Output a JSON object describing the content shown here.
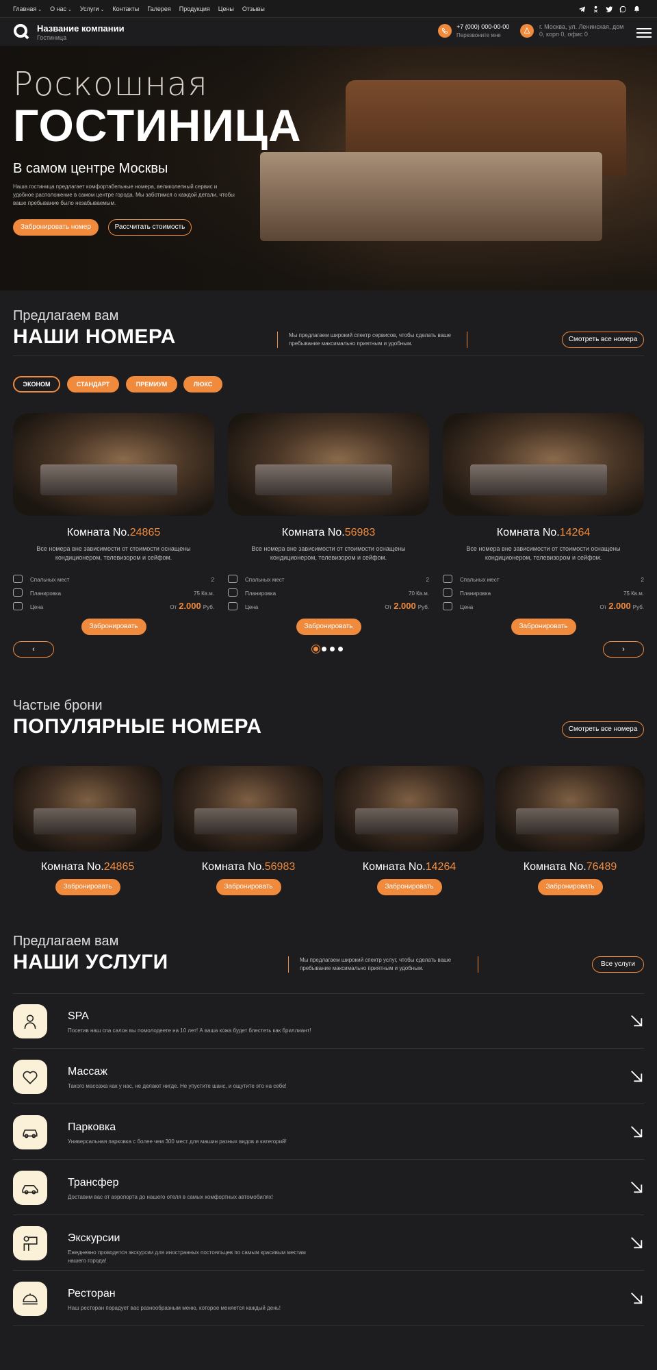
{
  "topnav": {
    "items": [
      "Главная",
      "О нас",
      "Услуги",
      "Контакты",
      "Галерея",
      "Продукция",
      "Цены",
      "Отзывы"
    ]
  },
  "socials": [
    "telegram-icon",
    "odnoklassniki-icon",
    "twitter-icon",
    "whatsapp-icon",
    "bell-icon"
  ],
  "header": {
    "company": "Название компании",
    "subtitle": "Гостиница",
    "phone": "+7 (000) 000-00-00",
    "phone_sub": "Перезвоните мне",
    "address": "г. Москва, ул. Ленинская, дом 0, корп 0, офис 0"
  },
  "hero": {
    "line1": "Роскошная",
    "line2": "ГОСТИНИЦА",
    "line3": "В самом центре Москвы",
    "desc": "Наша гостиница предлагает комфортабельные номера, великолепный сервис и удобное расположение в самом центре города. Мы заботимся о каждой детали, чтобы ваше пребывание было незабываемым.",
    "btn_book": "Забронировать номер",
    "btn_calc": "Рассчитать стоимость"
  },
  "rooms_section": {
    "small": "Предлагаем вам",
    "big": "НАШИ НОМЕРА",
    "desc": "Мы предлагаем широкий спектр сервисов, чтобы сделать ваше пребывание максимально приятным и удобным.",
    "btn": "Смотреть все номера",
    "filters": [
      "ЭКОНОМ",
      "СТАНДАРТ",
      "ПРЕМИУМ",
      "ЛЮКС"
    ],
    "active_filter": 0
  },
  "room_labels": {
    "beds": "Спальных мест",
    "layout": "Планировка",
    "price": "Цена",
    "from": "От",
    "currency": "Руб.",
    "book": "Забронировать",
    "desc": "Все номера вне зависимости от стоимости оснащены кондиционером, телевизором и сейфом."
  },
  "rooms": [
    {
      "prefix": "Комната No.",
      "num": "24865",
      "beds": "2",
      "area": "75 Кв.м.",
      "price": "2.000"
    },
    {
      "prefix": "Комната No.",
      "num": "56983",
      "beds": "2",
      "area": "70 Кв.м.",
      "price": "2.000"
    },
    {
      "prefix": "Комната No.",
      "num": "14264",
      "beds": "2",
      "area": "75 Кв.м.",
      "price": "2.000"
    }
  ],
  "slider": {
    "prev": "‹",
    "next": "›",
    "dots": 4,
    "active": 0
  },
  "popular_section": {
    "small": "Частые брони",
    "big": "ПОПУЛЯРНЫЕ НОМЕРА",
    "btn": "Смотреть все номера"
  },
  "popular": [
    {
      "prefix": "Комната No.",
      "num": "24865"
    },
    {
      "prefix": "Комната No.",
      "num": "56983"
    },
    {
      "prefix": "Комната No.",
      "num": "14264"
    },
    {
      "prefix": "Комната No.",
      "num": "76489"
    }
  ],
  "services_section": {
    "small": "Предлагаем вам",
    "big": "НАШИ УСЛУГИ",
    "desc": "Мы предлагаем широкий спектр услуг, чтобы сделать ваше пребывание максимально приятным и удобным.",
    "btn": "Все услуги"
  },
  "services": [
    {
      "title": "SPA",
      "icon": "spa-icon",
      "desc": "Посетив наш спа салон вы помолодеете на 10 лет! А ваша кожа будет блестеть как бриллиант!"
    },
    {
      "title": "Массаж",
      "icon": "massage-icon",
      "desc": "Такого массажа как у нас, не делают нигде. Не упустите шанс, и ощутите это на себе!"
    },
    {
      "title": "Парковка",
      "icon": "parking-icon",
      "desc": "Универсальная парковка с более чем 300 мест для машин разных видов и категорий!"
    },
    {
      "title": "Трансфер",
      "icon": "transfer-icon",
      "desc": "Доставим вас от аэропорта до нашего отеля в самых комфортных автомобилях!"
    },
    {
      "title": "Экскурсии",
      "icon": "excursion-icon",
      "desc": "Ежедневно проводятся экскурсии для иностранных постояльцев по самым красивым местам нашего города!"
    },
    {
      "title": "Ресторан",
      "icon": "restaurant-icon",
      "desc": "Наш ресторан порадует вас разнообразным меню, которое меняется каждый день!"
    }
  ],
  "colors": {
    "accent": "#f08a3c",
    "background": "#1d1d1f",
    "service_icon_bg": "#fbf1d9"
  }
}
